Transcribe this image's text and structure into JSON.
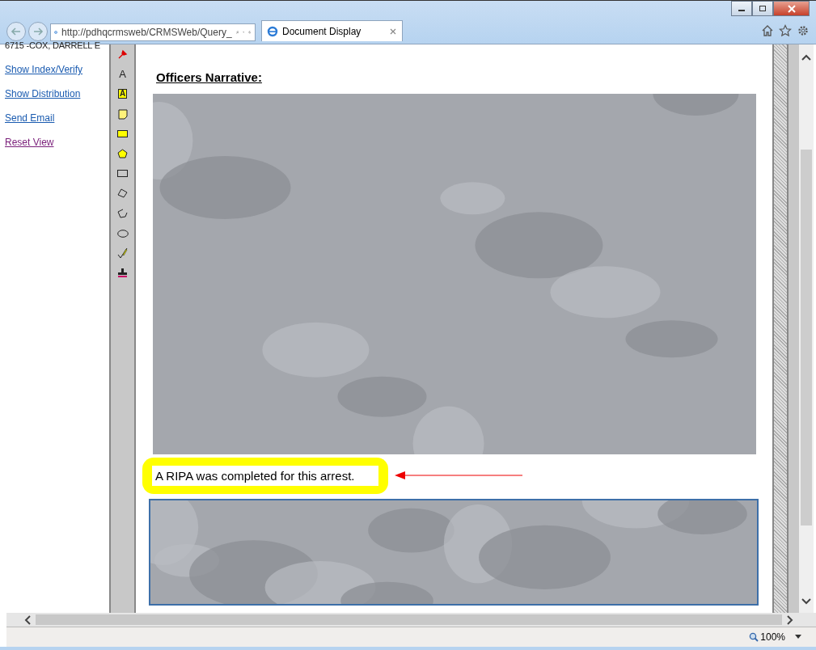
{
  "browser": {
    "address": "http://pdhqcrmsweb/CRMSWeb/Query_",
    "tab": {
      "title": "Document Display"
    }
  },
  "sidebar": {
    "header": "6715 -COX, DARRELL E",
    "links": [
      {
        "label": "Show Index/Verify",
        "visited": false
      },
      {
        "label": "Show Distribution",
        "visited": false
      },
      {
        "label": "Send Email",
        "visited": false
      },
      {
        "label": "Reset View",
        "visited": true
      }
    ]
  },
  "annotation_tools": [
    {
      "kind": "pin"
    },
    {
      "kind": "text",
      "glyph": "A"
    },
    {
      "kind": "textbox",
      "glyph": "A"
    },
    {
      "kind": "note"
    },
    {
      "kind": "highlight"
    },
    {
      "kind": "filled-polygon"
    },
    {
      "kind": "rectangle"
    },
    {
      "kind": "polygon"
    },
    {
      "kind": "polyline"
    },
    {
      "kind": "ellipse"
    },
    {
      "kind": "pencil"
    },
    {
      "kind": "stamp"
    }
  ],
  "document": {
    "heading": "Officers Narrative:",
    "callout": "A RIPA was completed for this arrest."
  },
  "status_bar": {
    "zoom": "100%"
  }
}
